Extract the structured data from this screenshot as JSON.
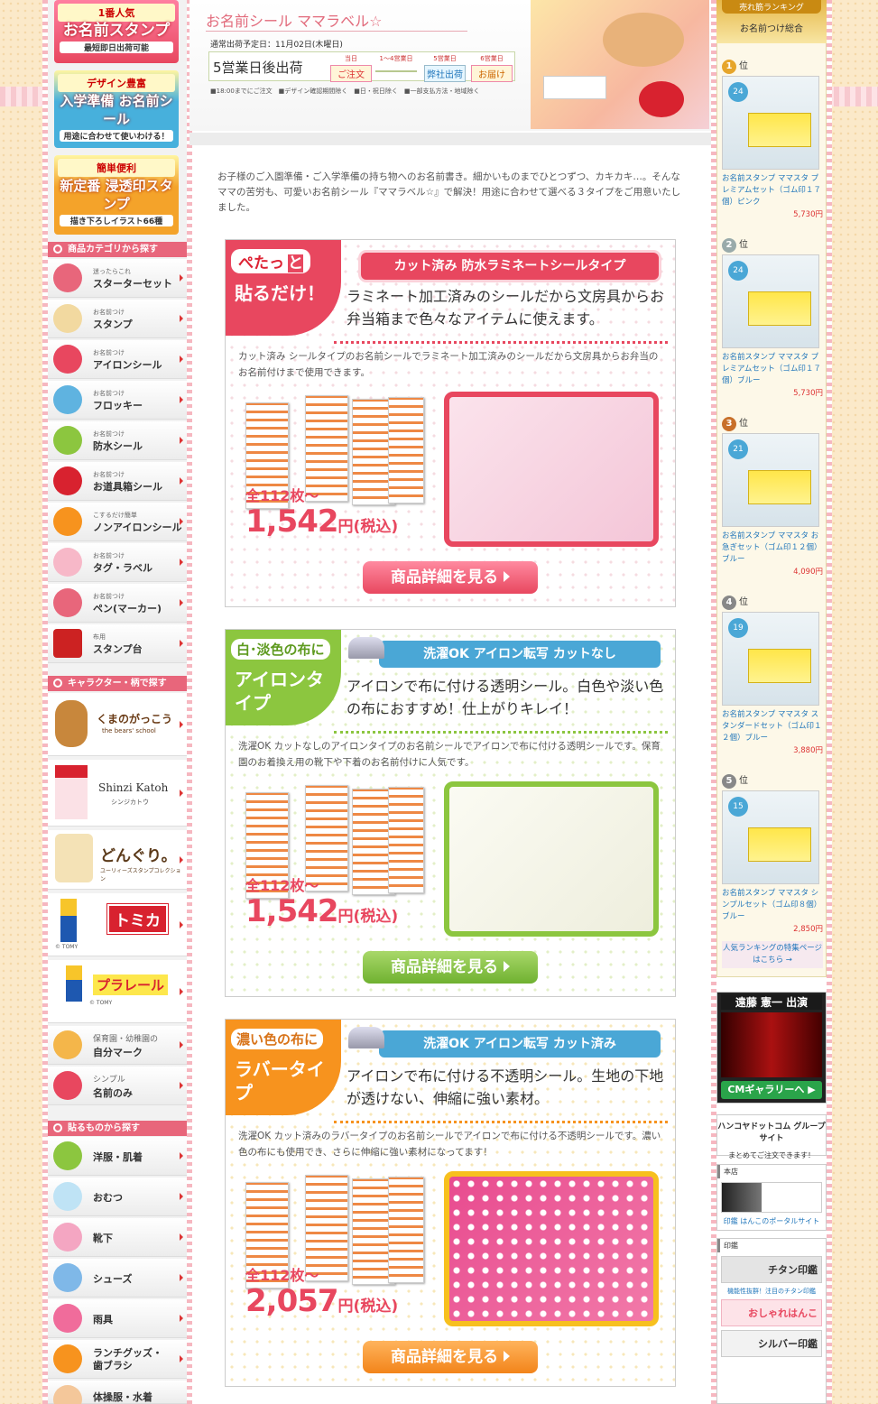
{
  "banners": [
    {
      "top": "1番人気",
      "main": "お名前スタンプ",
      "sub": "最短即日出荷可能"
    },
    {
      "top": "デザイン豊富",
      "main": "入学準備 お名前シール",
      "sub": "用途に合わせて使いわける！"
    },
    {
      "top": "簡単便利",
      "main": "新定番 浸透印スタンプ",
      "sub": "描き下ろしイラスト66種"
    }
  ],
  "nav": {
    "cat_head": "商品カテゴリから探す",
    "categories": [
      {
        "small": "迷ったらこれ",
        "label": "スターターセット"
      },
      {
        "small": "お名前つけ",
        "label": "スタンプ"
      },
      {
        "small": "お名前つけ",
        "label": "アイロンシール"
      },
      {
        "small": "お名前つけ",
        "label": "フロッキー"
      },
      {
        "small": "お名前つけ",
        "label": "防水シール"
      },
      {
        "small": "お名前つけ",
        "label": "お道具箱シール"
      },
      {
        "small": "こするだけ簡単",
        "label": "ノンアイロンシール"
      },
      {
        "small": "お名前つけ",
        "label": "タグ・ラベル"
      },
      {
        "small": "お名前つけ",
        "label": "ペン(マーカー)"
      },
      {
        "small": "布用",
        "label": "スタンプ台"
      }
    ],
    "chara_head": "キャラクター・柄で探す",
    "characters": [
      {
        "label": "くまのがっこう",
        "sub": "the bears' school"
      },
      {
        "label": "Shinzi Katoh",
        "sub": "シンジカトウ"
      },
      {
        "label": "どんぐり。",
        "sub": "ユーリィーズスタンプコレクション"
      },
      {
        "label": "トミカ",
        "sub": "© TOMY"
      },
      {
        "label": "プラレール",
        "sub": "© TOMY"
      }
    ],
    "extra": [
      {
        "small": "保育園・幼稚園の",
        "label": "自分マーク"
      },
      {
        "small": "シンプル",
        "label": "名前のみ"
      }
    ],
    "stick_head": "貼るものから探す",
    "stick": [
      "洋服・肌着",
      "おむつ",
      "靴下",
      "シューズ",
      "雨具",
      "ランチグッズ・歯ブラシ",
      "体操服・水着"
    ]
  },
  "header": {
    "title": "お名前シール ママラベル☆",
    "ship_date": "通常出荷予定日：11月02日(木曜日)",
    "ship_big": "5営業日後出荷",
    "steps": [
      {
        "top": "当日",
        "label": "ご注文"
      },
      {
        "top": "1〜4営業日",
        "label": ""
      },
      {
        "top": "5営業日",
        "label": "弊社出荷"
      },
      {
        "top": "6営業日",
        "label": "お届け"
      }
    ],
    "notes": "■18:00までにご注文　■デザイン確認期間除く　■日・祝日除く　■一部支払方法・地域除く"
  },
  "intro": "お子様のご入園準備・ご入学準備の持ち物へのお名前書き。細かいものまでひとつずつ、カキカキ…。そんなママの苦労も、可愛いお名前シール『ママラベル☆』で解決！用途に合わせて選べる３タイプをご用意いたしました。",
  "products": [
    {
      "badge1": "ぺたっ",
      "badge1b": "と",
      "badge2": "貼るだけ！",
      "tag": "カット済み 防水ラミネートシールタイプ",
      "desc": "ラミネート加工済みのシールだから文房具からお弁当箱まで色々なアイテムに使えます。",
      "small": "カット済み シールタイプのお名前シールでラミネート加工済みのシールだから文房具からお弁当のお名前付けまで使用できます。",
      "count": "全112枚〜",
      "price": "1,542",
      "unit": "円(税込)",
      "button": "商品詳細を見る"
    },
    {
      "badge1": "白･淡色の布に",
      "badge1b": "",
      "badge2": "アイロンタイプ",
      "tag": "洗濯OK アイロン転写 カットなし",
      "desc": "アイロンで布に付ける透明シール。白色や淡い色の布におすすめ！仕上がりキレイ！",
      "small": "洗濯OK カットなしのアイロンタイプのお名前シールでアイロンで布に付ける透明シールです。保育園のお着換え用の靴下や下着のお名前付けに人気です。",
      "count": "全112枚〜",
      "price": "1,542",
      "unit": "円(税込)",
      "button": "商品詳細を見る"
    },
    {
      "badge1": "濃い色の布に",
      "badge1b": "",
      "badge2": "ラバータイプ",
      "tag": "洗濯OK アイロン転写 カット済み",
      "desc": "アイロンで布に付ける不透明シール。生地の下地が透けない、伸縮に強い素材。",
      "small": "洗濯OK カット済みのラバータイプのお名前シールでアイロンで布に付ける不透明シールです。濃い色の布にも使用でき、さらに伸縮に強い素材になってます！",
      "count": "全112枚〜",
      "price": "2,057",
      "unit": "円(税込)",
      "button": "商品詳細を見る"
    }
  ],
  "ranking": {
    "label": "売れ筋ランキング",
    "title": "お名前つけ総合",
    "items": [
      {
        "rank": "1",
        "pos": "位",
        "set": "24",
        "name": "お名前スタンプ ママスタ プレミアムセット（ゴム印１７個）ピンク",
        "price": "5,730円"
      },
      {
        "rank": "2",
        "pos": "位",
        "set": "24",
        "name": "お名前スタンプ ママスタ プレミアムセット（ゴム印１７個）ブルー",
        "price": "5,730円"
      },
      {
        "rank": "3",
        "pos": "位",
        "set": "21",
        "name": "お名前スタンプ ママスタ お急ぎセット（ゴム印１２個）ブルー",
        "price": "4,090円"
      },
      {
        "rank": "4",
        "pos": "位",
        "set": "19",
        "name": "お名前スタンプ ママスタ スタンダードセット（ゴム印１２個）ブルー",
        "price": "3,880円"
      },
      {
        "rank": "5",
        "pos": "位",
        "set": "15",
        "name": "お名前スタンプ ママスタ シンプルセット（ゴム印８個）ブルー",
        "price": "2,850円"
      }
    ],
    "footer": "人気ランキングの特集ページはこちら →"
  },
  "side": {
    "cm_head": "遠藤 憲一 出演",
    "cm_btn": "CMギャラリーへ ▶",
    "group_title": "ハンコヤドットコム グループサイト",
    "group_sub": "まとめてご注文できます！",
    "honten": "本店",
    "honten_link": "印鑑 はんこのポータルサイト",
    "inkan": "印鑑",
    "links": [
      "チタン印鑑",
      "おしゃれはんこ",
      "シルバー印鑑"
    ],
    "titan_note": "機能性抜群！注目のチタン印鑑"
  },
  "colors": {
    "pink": "#e8475f",
    "green": "#8cc63f",
    "orange": "#f7931e",
    "blue": "#4aa7d6"
  }
}
